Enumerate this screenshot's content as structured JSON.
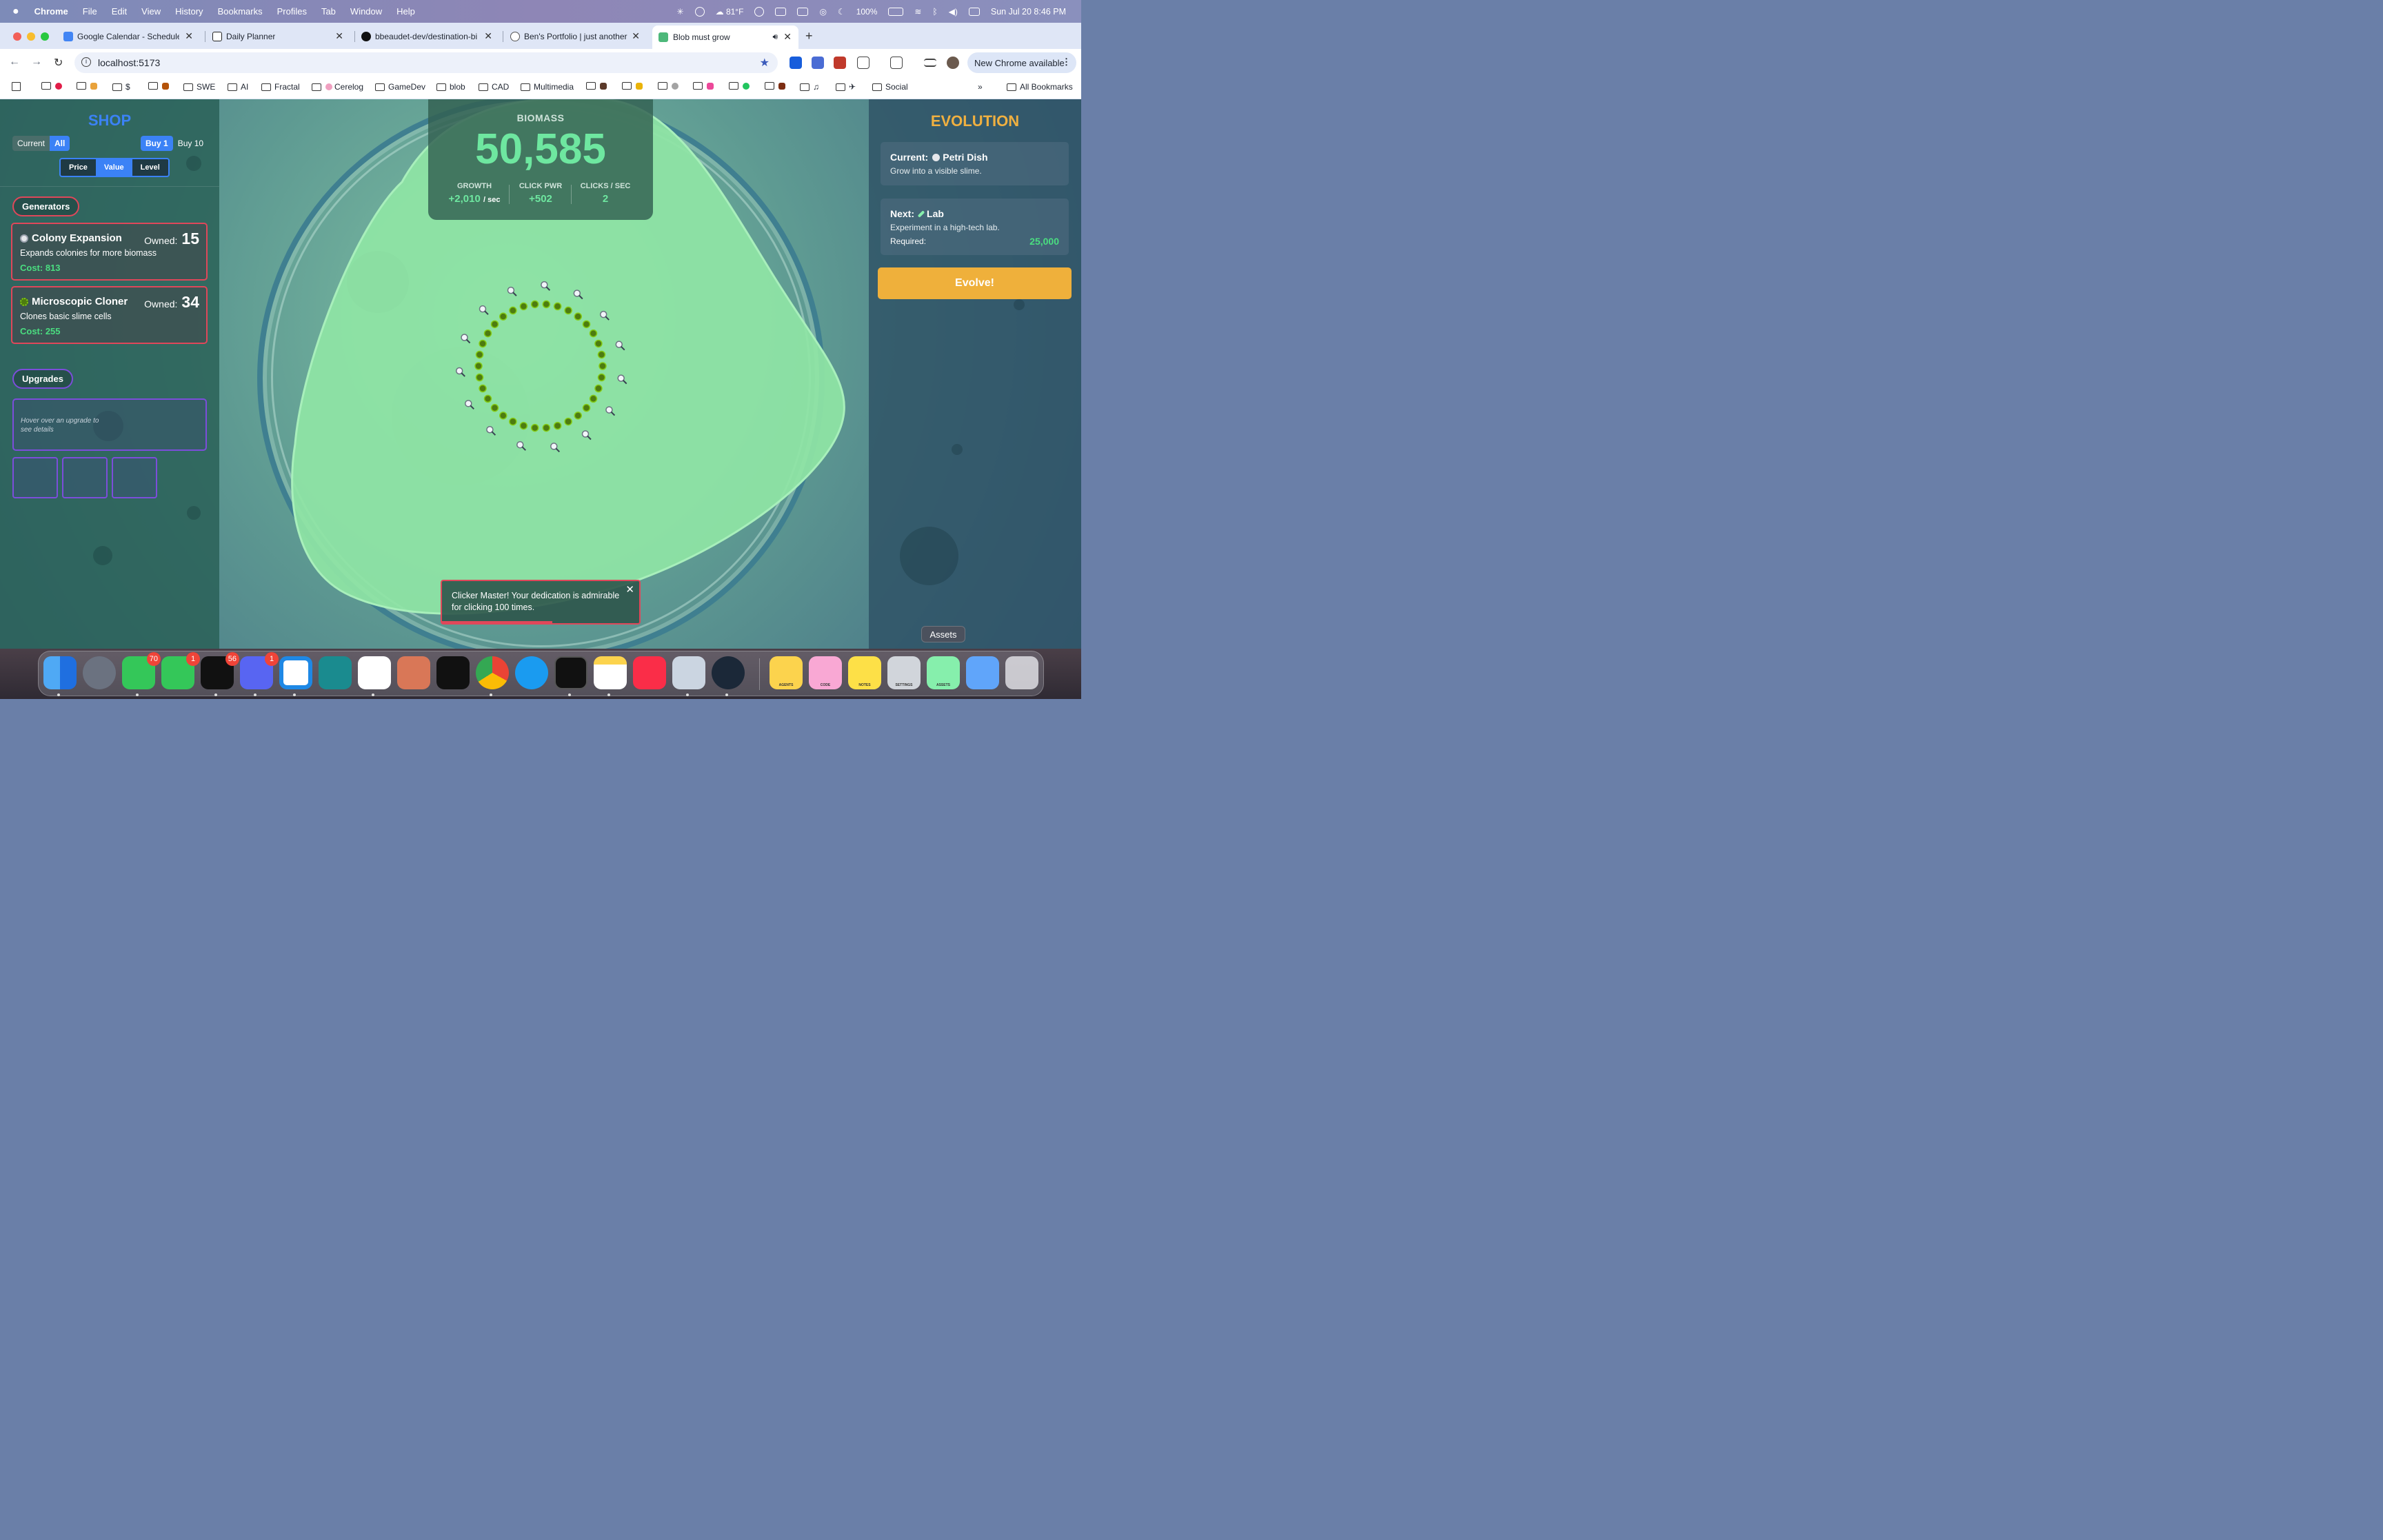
{
  "menubar": {
    "app": "Chrome",
    "items": [
      "File",
      "Edit",
      "View",
      "History",
      "Bookmarks",
      "Profiles",
      "Tab",
      "Window",
      "Help"
    ],
    "weather": "81°F",
    "battery": "100%",
    "datetime": "Sun Jul 20  8:46 PM"
  },
  "tabs": [
    {
      "title": "Google Calendar - Schedule",
      "fav": "#4285f4"
    },
    {
      "title": "Daily Planner",
      "fav": "#222"
    },
    {
      "title": "bbeaudet-dev/destination-bi",
      "fav": "#111"
    },
    {
      "title": "Ben's Portfolio | just another",
      "fav": "#555"
    },
    {
      "title": "Blob must grow",
      "fav": "#4db87a"
    }
  ],
  "address": {
    "url": "localhost:5173",
    "update_label": "New Chrome available"
  },
  "bookmarks": [
    "$",
    "SWE",
    "AI",
    "Fractal",
    "Cerelog",
    "GameDev",
    "blob",
    "CAD",
    "Multimedia",
    "Social"
  ],
  "bookmarks_all": "All Bookmarks",
  "shop": {
    "title": "SHOP",
    "filter": {
      "current": "Current",
      "all": "All"
    },
    "buy": {
      "one": "Buy 1",
      "ten": "Buy 10"
    },
    "sort": {
      "price": "Price",
      "value": "Value",
      "level": "Level"
    },
    "generators_label": "Generators",
    "generators": [
      {
        "name": "Colony Expansion",
        "owned_label": "Owned:",
        "owned": "15",
        "desc": "Expands colonies for more biomass",
        "cost": "Cost: 813",
        "icon": "magnifier-icon"
      },
      {
        "name": "Microscopic Cloner",
        "owned_label": "Owned:",
        "owned": "34",
        "desc": "Clones basic slime cells",
        "cost": "Cost: 255",
        "icon": "microbe-icon"
      }
    ],
    "upgrades_label": "Upgrades",
    "upgrades_hint": "Hover over an upgrade to see details"
  },
  "stats": {
    "biomass_label": "BIOMASS",
    "biomass": "50,585",
    "growth_label": "GROWTH",
    "growth": "+2,010",
    "growth_unit": "/ sec",
    "click_label": "CLICK PWR",
    "click": "+502",
    "cps_label": "CLICKS / SEC",
    "cps": "2"
  },
  "toast": {
    "text": "Clicker Master! Your dedication is admirable for clicking 100 times.",
    "progress": 0.56
  },
  "evolution": {
    "title": "EVOLUTION",
    "current_label": "Current:",
    "current_name": "Petri Dish",
    "current_desc": "Grow into a visible slime.",
    "next_label": "Next:",
    "next_name": "Lab",
    "next_desc": "Experiment in a high-tech lab.",
    "required_label": "Required:",
    "required": "25,000",
    "evolve_button": "Evolve!"
  },
  "dock": {
    "tooltip": "Assets",
    "badges": {
      "messages": "70",
      "facetime": "1",
      "stack": "56",
      "discord": "1"
    },
    "labels": [
      "AGENTS",
      "CODE",
      "NOTES",
      "SETTINGS",
      "ASSETS"
    ]
  },
  "colors": {
    "accent_blue": "#3b82f6",
    "generator_red": "#e0475a",
    "upgrade_purple": "#7c4ddb",
    "biomass_green": "#6ee7a0",
    "evolve_orange": "#efb03b"
  }
}
